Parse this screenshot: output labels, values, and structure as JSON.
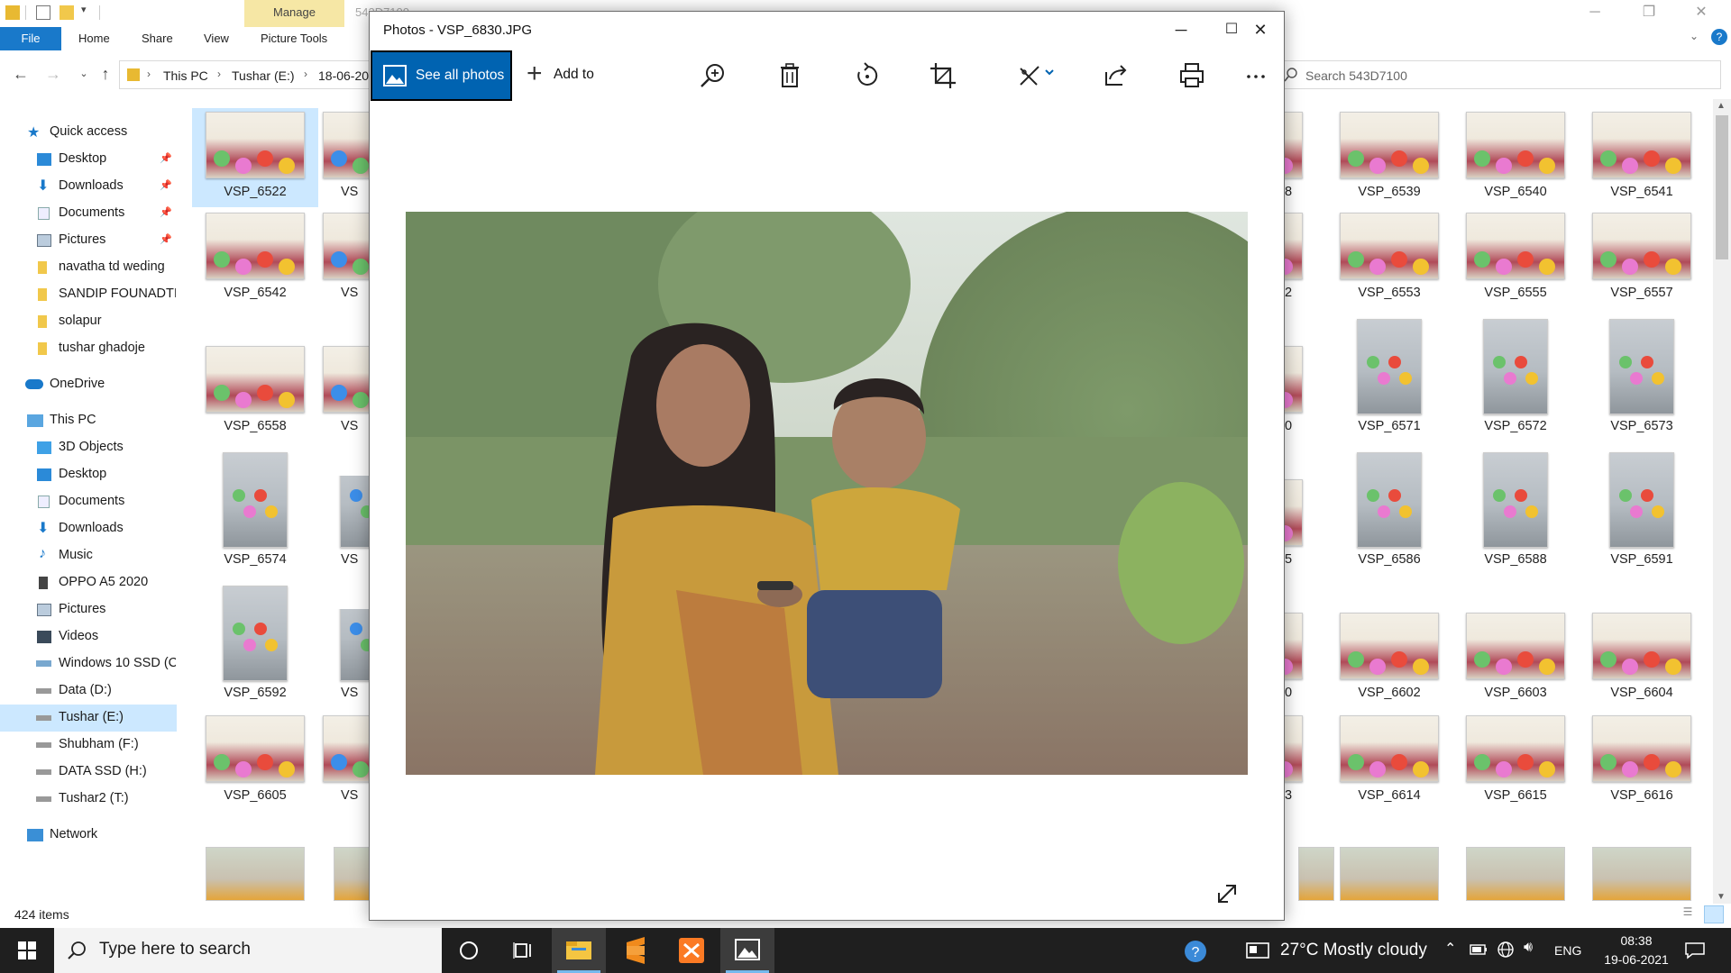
{
  "explorer": {
    "title": "543D7100",
    "manage_tab": "Manage",
    "ribbon_tabs": [
      "File",
      "Home",
      "Share",
      "View",
      "Picture Tools"
    ],
    "breadcrumb": [
      "This PC",
      "Tushar (E:)",
      "18-06-20"
    ],
    "search_placeholder": "Search 543D7100",
    "nav": {
      "quick_access": "Quick access",
      "quick_items": [
        "Desktop",
        "Downloads",
        "Documents",
        "Pictures",
        "navatha td weding",
        "SANDIP FOUNADTI(",
        "solapur",
        "tushar ghadoje"
      ],
      "onedrive": "OneDrive",
      "this_pc": "This PC",
      "pc_items": [
        "3D Objects",
        "Desktop",
        "Documents",
        "Downloads",
        "Music",
        "OPPO A5 2020",
        "Pictures",
        "Videos",
        "Windows 10 SSD (C",
        "Data (D:)",
        "Tushar (E:)",
        "Shubham (F:)",
        "DATA SSD (H:)",
        "Tushar2 (T:)"
      ],
      "network": "Network"
    },
    "left_col1": [
      "VSP_6522",
      "VSP_6542",
      "VSP_6558",
      "VSP_6574",
      "VSP_6592",
      "VSP_6605"
    ],
    "left_col2": [
      "VS",
      "VS",
      "VS",
      "VS",
      "VS",
      "VS"
    ],
    "right_partial": [
      "8",
      "2",
      "0",
      "5",
      "0",
      "3"
    ],
    "right_cols": [
      [
        "VSP_6539",
        "VSP_6540",
        "VSP_6541"
      ],
      [
        "VSP_6553",
        "VSP_6555",
        "VSP_6557"
      ],
      [
        "VSP_6571",
        "VSP_6572",
        "VSP_6573"
      ],
      [
        "VSP_6586",
        "VSP_6588",
        "VSP_6591"
      ],
      [
        "VSP_6602",
        "VSP_6603",
        "VSP_6604"
      ],
      [
        "VSP_6614",
        "VSP_6615",
        "VSP_6616"
      ]
    ],
    "item_count": "424 items"
  },
  "photos": {
    "title": "Photos - VSP_6830.JPG",
    "see_all": "See all photos",
    "add_to": "Add to",
    "tool_icons": [
      "zoom-in-icon",
      "delete-icon",
      "rotate-icon",
      "crop-icon",
      "edit-icon",
      "share-icon",
      "print-icon",
      "more-icon"
    ]
  },
  "taskbar": {
    "search_placeholder": "Type here to search",
    "weather": "27°C  Mostly cloudy",
    "lang": "ENG",
    "time": "08:38",
    "date": "19-06-2021"
  },
  "colors": {
    "accent": "#0063b1",
    "file_tab": "#1979ca",
    "selection": "#cce8ff",
    "manage_tab": "#f6e7a5",
    "taskbar": "#1f1f1f"
  }
}
